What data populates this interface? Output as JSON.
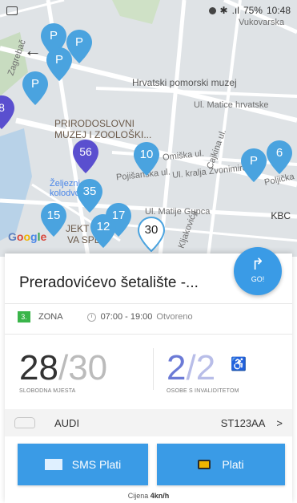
{
  "statusbar": {
    "battery": "75%",
    "time": "10:48",
    "signal": ".ıl"
  },
  "map": {
    "labels": {
      "museum": "Hrvatski pomorski muzej",
      "prirodoslovni1": "PRIRODOSLOVNI",
      "prirodoslovni2": "MUZEJ I ZOOLOŠKI...",
      "matice": "Ul. Matice hrvatske",
      "omiska": "Omiška ul.",
      "kralja": "Ul. kralja Zvonimira",
      "poljicka": "Poljička",
      "pojisanska": "Pojišanska ul.",
      "mazte": "Ul. Matije Gupca",
      "zeljeznicka1": "Željezni",
      "zeljeznicka2": "kolodvo",
      "vukovarska": "Vukovarska",
      "zagrebacka": "Zagrebač",
      "cajkina": "Cajkina ul.",
      "kljaka": "Kljakovića",
      "projekt": "JEKT",
      "splitova": "VA SPLI",
      "kbc": "KBC"
    },
    "pins": {
      "p": "P",
      "p56": "56",
      "p10": "10",
      "p35": "35",
      "p15": "15",
      "p17": "17",
      "p12": "12",
      "p30": "30",
      "p6": "6",
      "p8": "8"
    },
    "google": {
      "g": "G",
      "o1": "o",
      "o2": "o",
      "g2": "g",
      "l": "l",
      "e": "e"
    }
  },
  "sheet": {
    "title": "Preradovićevo šetalište -...",
    "go_label": "GO!",
    "zone_number": "3.",
    "zone_label": "ZONA",
    "hours": "07:00 - 19:00",
    "open_status": "Otvoreno",
    "free": {
      "count": "28",
      "slash": "/",
      "total": "30",
      "label": "SLOBODNA MJESTA"
    },
    "invalid": {
      "count": "2",
      "slash": "/",
      "total": "2",
      "label": "OSOBE S INVALIDITETOM"
    },
    "car_name": "AUDI",
    "plate": "ST123AA",
    "chevron": ">",
    "sms_label": "SMS Plati",
    "pay_label": "Plati",
    "price_prefix": "Cijena",
    "price_value": "4kn/h"
  },
  "colors": {
    "accent_blue": "#3a9be6",
    "pin_blue": "#4aa3df",
    "pin_purple": "#5a4fcf",
    "zone_green": "#3ab54a",
    "invalid_purple": "#6b7ad6"
  }
}
